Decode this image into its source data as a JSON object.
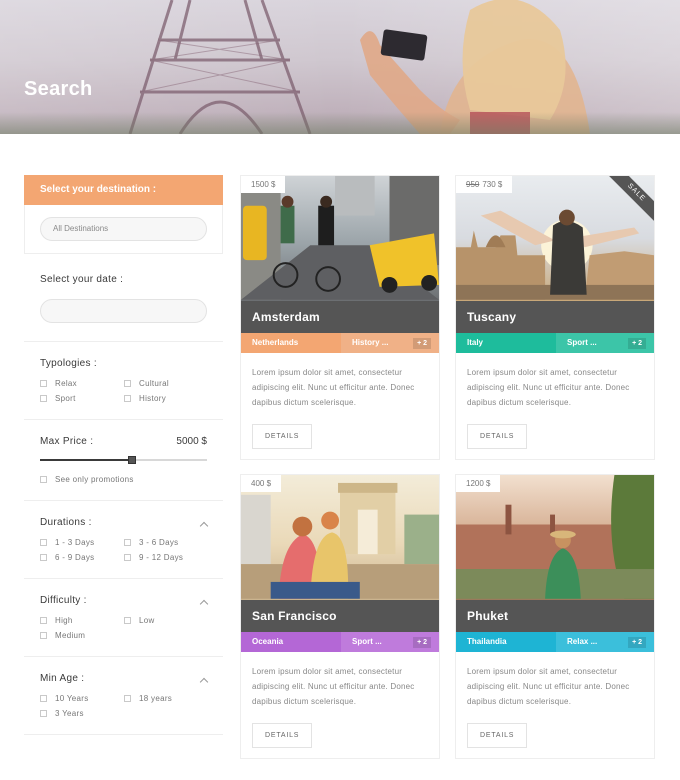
{
  "hero": {
    "title": "Search"
  },
  "sidebar": {
    "destination_header": "Select your destination :",
    "destination_placeholder": "All Destinations",
    "date_label": "Select your date :",
    "typologies": {
      "label": "Typologies :",
      "options": [
        "Relax",
        "Cultural",
        "Sport",
        "History"
      ]
    },
    "max_price": {
      "label": "Max Price :",
      "value": "5000 $",
      "slider_fraction": 0.55,
      "promo_label": "See only promotions"
    },
    "durations": {
      "label": "Durations :",
      "options": [
        "1 - 3 Days",
        "3 - 6 Days",
        "6 - 9 Days",
        "9 - 12 Days"
      ]
    },
    "difficulty": {
      "label": "Difficulty :",
      "options": [
        "High",
        "Low",
        "Medium"
      ]
    },
    "min_age": {
      "label": "Min Age :",
      "options": [
        "10 Years",
        "18 years",
        "3 Years"
      ]
    }
  },
  "cards": [
    {
      "title": "Amsterdam",
      "price": "1500 $",
      "old_price": "",
      "sale": "",
      "tag_a": "Netherlands",
      "tag_b": "History ...",
      "plus": "+ 2",
      "color_a": "#f3a672",
      "color_b": "#f0b187",
      "text": "Lorem ipsum dolor sit amet, consectetur adipiscing elit. Nunc ut efficitur ante. Donec dapibus dictum scelerisque.",
      "button": "DETAILS"
    },
    {
      "title": "Tuscany",
      "price": "730 $",
      "old_price": "950",
      "sale": "SALE",
      "tag_a": "Italy",
      "tag_b": "Sport ...",
      "plus": "+ 2",
      "color_a": "#1ebc9c",
      "color_b": "#3cc5a8",
      "text": "Lorem ipsum dolor sit amet, consectetur adipiscing elit. Nunc ut efficitur ante. Donec dapibus dictum scelerisque.",
      "button": "DETAILS"
    },
    {
      "title": "San Francisco",
      "price": "400 $",
      "old_price": "",
      "sale": "",
      "tag_a": "Oceania",
      "tag_b": "Sport ...",
      "plus": "+ 2",
      "color_a": "#b467d6",
      "color_b": "#bf7bdc",
      "text": "Lorem ipsum dolor sit amet, consectetur adipiscing elit. Nunc ut efficitur ante. Donec dapibus dictum scelerisque.",
      "button": "DETAILS"
    },
    {
      "title": "Phuket",
      "price": "1200 $",
      "old_price": "",
      "sale": "",
      "tag_a": "Thailandia",
      "tag_b": "Relax ...",
      "plus": "+ 2",
      "color_a": "#1eb4d4",
      "color_b": "#3bbfdb",
      "text": "Lorem ipsum dolor sit amet, consectetur adipiscing elit. Nunc ut efficitur ante. Donec dapibus dictum scelerisque.",
      "button": "DETAILS"
    }
  ]
}
